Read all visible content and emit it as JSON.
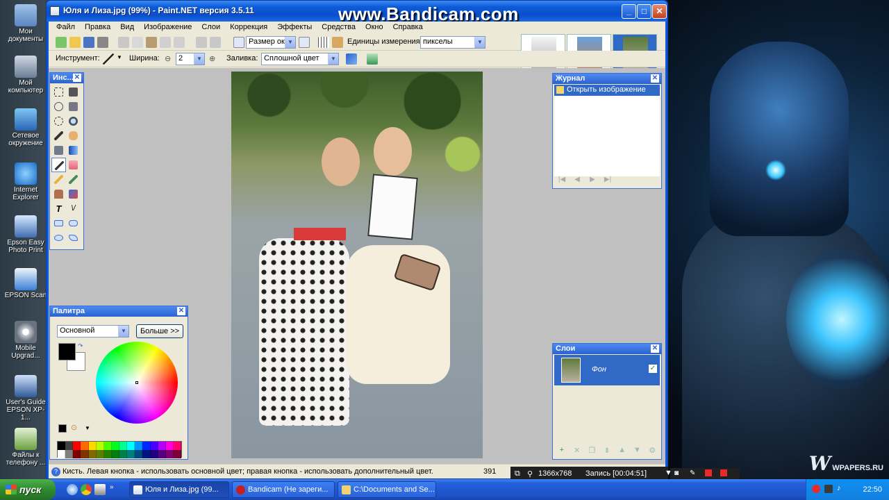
{
  "window": {
    "title": "Юля и Лиза.jpg (99%) - Paint.NET версия 3.5.11",
    "min": "_",
    "max": "□",
    "close": "✕"
  },
  "watermark": "www.Bandicam.com",
  "menu": [
    "Файл",
    "Правка",
    "Вид",
    "Изображение",
    "Слои",
    "Коррекция",
    "Эффекты",
    "Средства",
    "Окно",
    "Справка"
  ],
  "toolbar1": {
    "zoom_value": "Размер окн",
    "units_label": "Единицы измерения:",
    "units_value": "пикселы"
  },
  "toolbar2": {
    "tool_label": "Инструмент:",
    "width_label": "Ширина:",
    "width_value": "2",
    "fill_label": "Заливка:",
    "fill_value": "Сплошной цвет"
  },
  "tools_panel": {
    "title": "Инс..."
  },
  "history_panel": {
    "title": "Журнал",
    "items": [
      "Открыть изображение"
    ]
  },
  "layers_panel": {
    "title": "Слои",
    "layers": [
      "Фон"
    ]
  },
  "palette_panel": {
    "title": "Палитра",
    "mode_value": "Основной",
    "more_button": "Больше >>"
  },
  "statusbar": {
    "message": "Кисть. Левая кнопка - использовать основной цвет; правая кнопка - использовать дополнительный цвет.",
    "coords": "391"
  },
  "bandicam_bar": {
    "resolution": "1366x768",
    "recording": "Запись [00:04:51]"
  },
  "desktop_icons": [
    "Мои документы",
    "Мой компьютер",
    "Сетевое окружение",
    "Internet Explorer",
    "Epson Easy Photo Print",
    "EPSON Scan",
    "Mobile Upgrad...",
    "User's Guide EPSON XP-1...",
    "Файлы к телефону ..."
  ],
  "taskbar": {
    "start": "пуск",
    "tasks": [
      "Юля и Лиза.jpg (99...",
      "Bandicam (Не зареги...",
      "C:\\Documents and Se..."
    ],
    "clock": "22:50"
  },
  "wallpaper_logo": "WPAPERS.RU"
}
